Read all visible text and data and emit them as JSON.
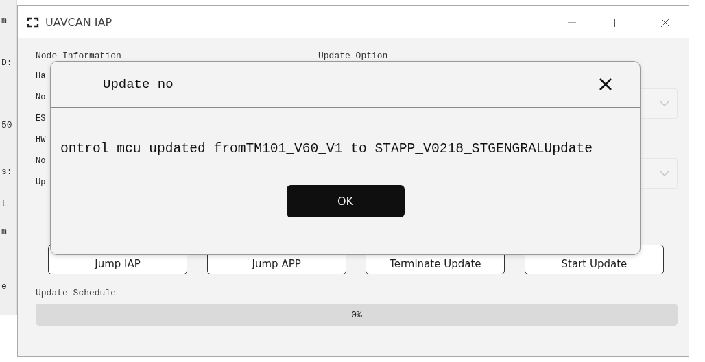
{
  "background_fragments": [
    "m",
    "D:",
    "50",
    "s:",
    "t",
    "m",
    "e"
  ],
  "window": {
    "title": "UAVCAN IAP"
  },
  "node_information": {
    "heading": "Node Information",
    "labels": [
      "Ha",
      "No",
      "ES",
      "HW",
      "No",
      "Up"
    ]
  },
  "update_option": {
    "heading": "Update Option"
  },
  "buttons": [
    "Jump IAP",
    "Jump APP",
    "Terminate Update",
    "Start Update"
  ],
  "update_schedule": {
    "label": "Update Schedule",
    "level": 0,
    "reading": "0%"
  },
  "dialog": {
    "title": "Update no",
    "message": "ontrol mcu updated fromTM101_V60_V1 to STAPP_V0218_STGENGRALUpdate",
    "button": "OK"
  }
}
